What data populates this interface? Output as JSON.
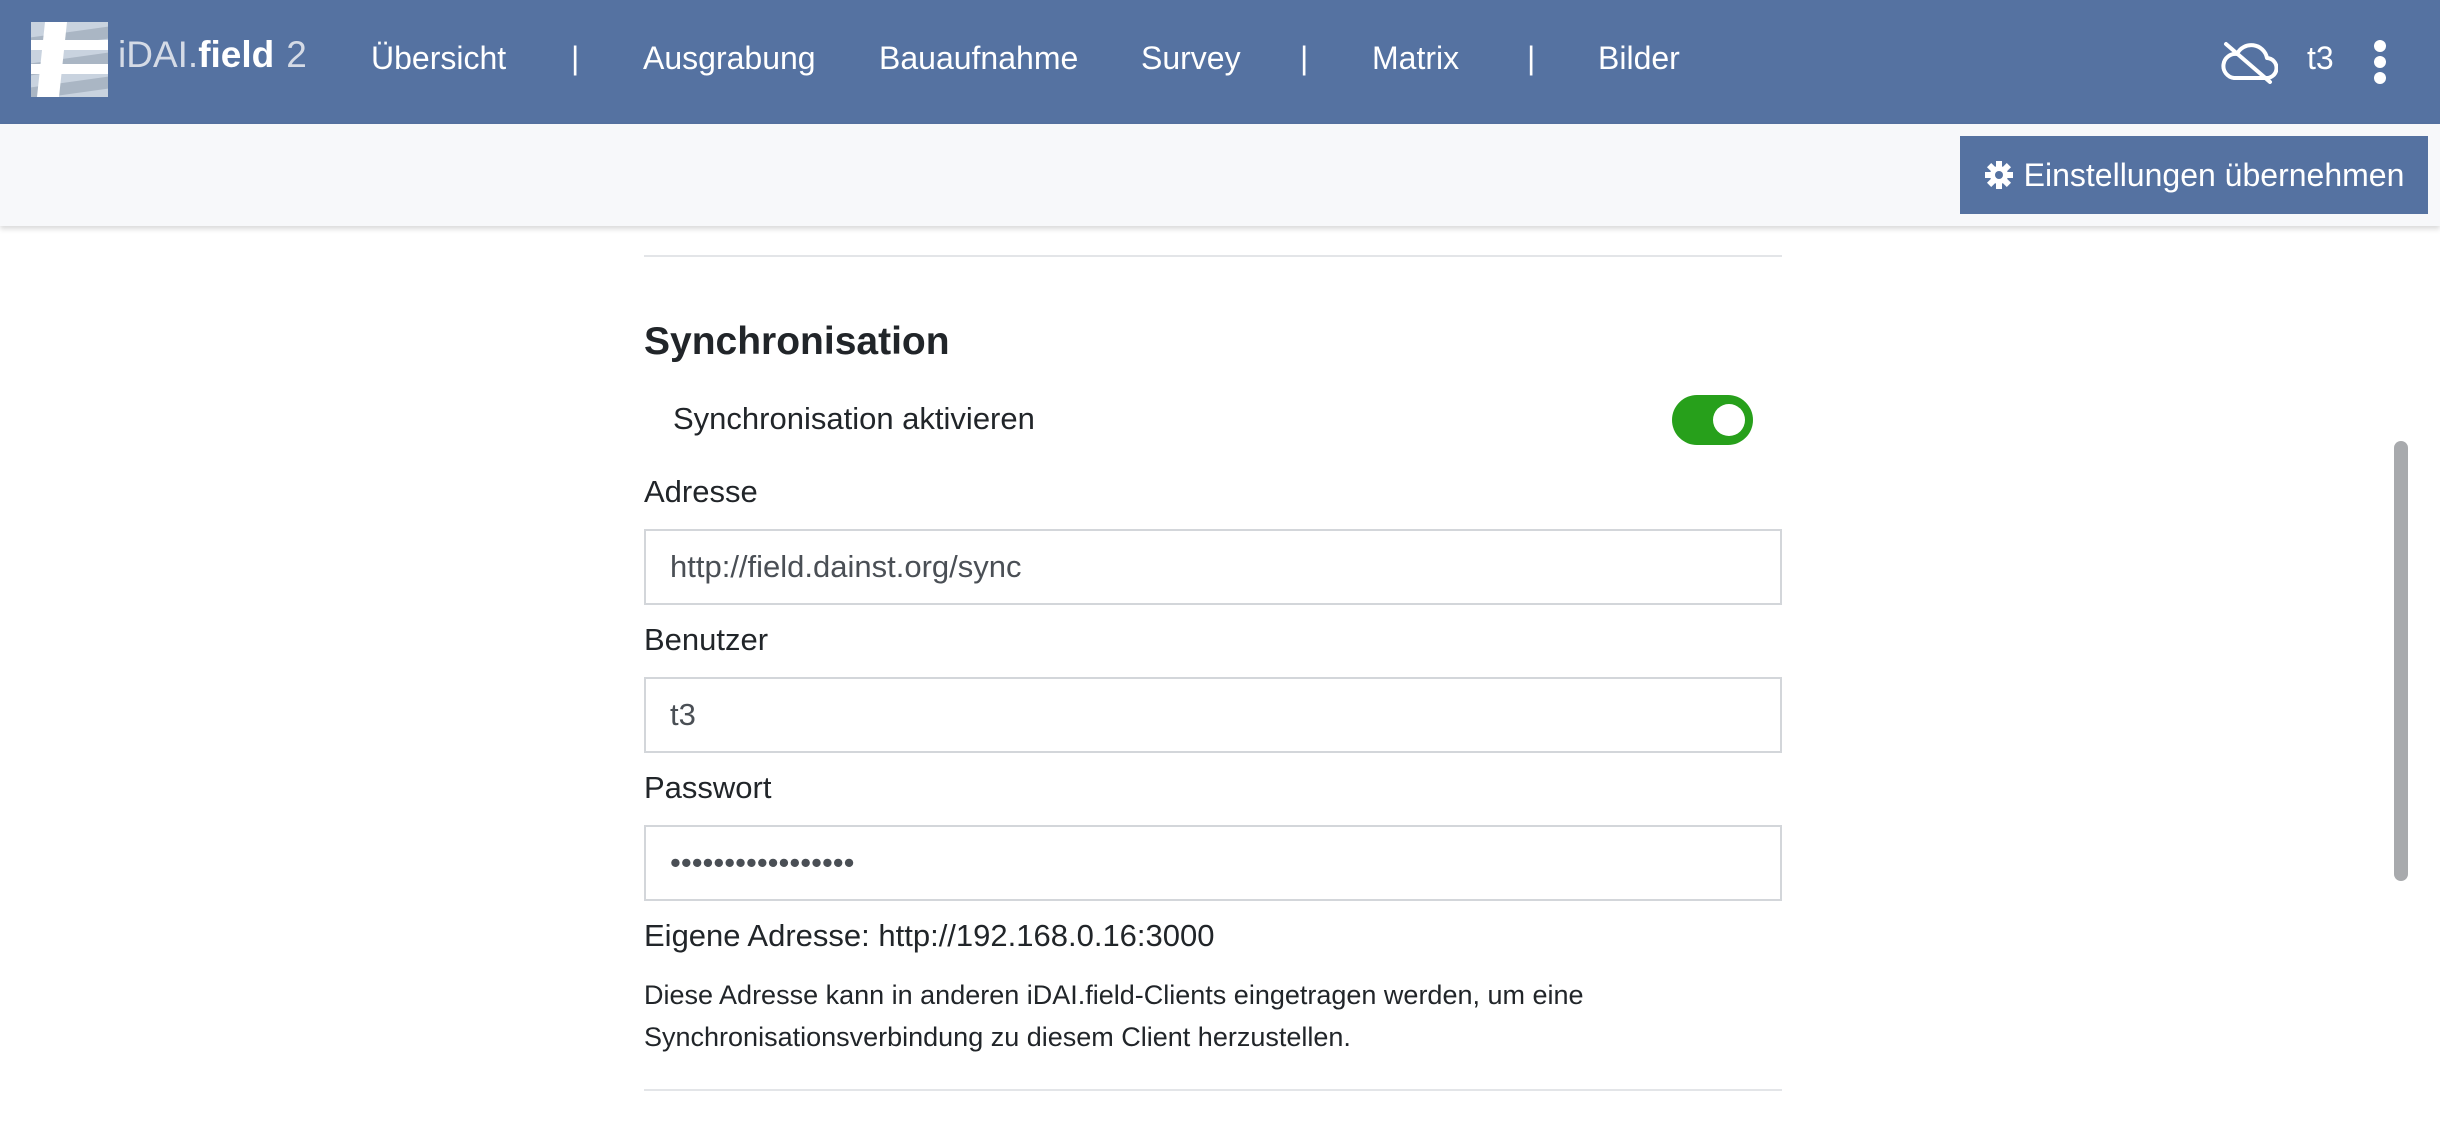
{
  "app": {
    "brand_prefix": "iDAI.",
    "brand_name": "field",
    "brand_version": "2"
  },
  "nav": {
    "items": [
      {
        "label": "Übersicht"
      },
      {
        "label": "Ausgrabung"
      },
      {
        "label": "Bauaufnahme"
      },
      {
        "label": "Survey"
      },
      {
        "label": "Matrix"
      },
      {
        "label": "Bilder"
      }
    ],
    "separator": "|",
    "sync_status_icon": "cloud-off-icon",
    "user": "t3",
    "menu_icon": "kebab-menu-icon"
  },
  "toolbar": {
    "apply_label": "Einstellungen übernehmen",
    "apply_icon": "gear-icon"
  },
  "sync": {
    "title": "Synchronisation",
    "toggle_label": "Synchronisation aktivieren",
    "toggle_on": true,
    "address_label": "Adresse",
    "address_value": "http://field.dainst.org/sync",
    "user_label": "Benutzer",
    "user_value": "t3",
    "password_label": "Passwort",
    "password_value": "•••••••••••••••••",
    "own_address": "Eigene Adresse: http://192.168.0.16:3000",
    "help_text": "Diese Adresse kann in anderen iDAI.field-Clients eingetragen werden, um eine Synchronisationsverbindung zu diesem Client herzustellen."
  },
  "colors": {
    "navbar": "#5572a1",
    "toggle_on": "#27a01b",
    "toolbar_bg": "#f7f8fa"
  }
}
